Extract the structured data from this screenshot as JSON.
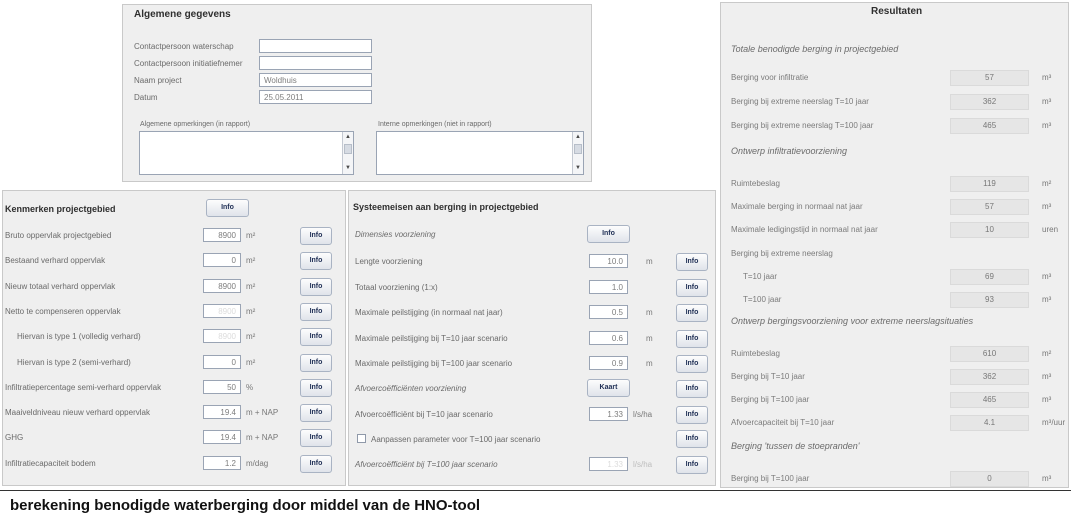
{
  "general": {
    "title": "Algemene gegevens",
    "rows": [
      {
        "label": "Contactpersoon waterschap",
        "value": ""
      },
      {
        "label": "Contactpersoon initiatiefnemer",
        "value": ""
      },
      {
        "label": "Naam project",
        "value": "Woldhuis"
      },
      {
        "label": "Datum",
        "value": "25.05.2011"
      }
    ],
    "remarks_report_label": "Algemene opmerkingen (in rapport)",
    "remarks_internal_label": "Interne opmerkingen (niet in rapport)"
  },
  "project": {
    "title": "Kenmerken projectgebied",
    "info_label": "Info",
    "rows": [
      {
        "label": "Bruto oppervlak projectgebied",
        "value": "8900",
        "unit": "m²",
        "disabled": false
      },
      {
        "label": "Bestaand verhard oppervlak",
        "value": "0",
        "unit": "m²",
        "disabled": false
      },
      {
        "label": "Nieuw totaal verhard oppervlak",
        "value": "8900",
        "unit": "m²",
        "disabled": false
      },
      {
        "label": "Netto te compenseren oppervlak",
        "value": "8900",
        "unit": "m²",
        "disabled": true
      },
      {
        "label": "Hiervan is type 1 (volledig verhard)",
        "value": "8900",
        "unit": "m²",
        "disabled": true
      },
      {
        "label": "Hiervan is type 2 (semi-verhard)",
        "value": "0",
        "unit": "m²",
        "disabled": false
      },
      {
        "label": "Infiltratiepercentage semi-verhard oppervlak",
        "value": "50",
        "unit": "%",
        "disabled": false
      },
      {
        "label": "Maaiveldniveau nieuw verhard oppervlak",
        "value": "19.4",
        "unit": "m + NAP",
        "disabled": false
      },
      {
        "label": "GHG",
        "value": "19.4",
        "unit": "m + NAP",
        "disabled": false
      },
      {
        "label": "Infiltratiecapaciteit bodem",
        "value": "1.2",
        "unit": "m/dag",
        "disabled": false
      }
    ]
  },
  "system": {
    "title": "Systeemeisen aan berging in projectgebied",
    "dimension_label": "Dimensies voorziening",
    "info_label": "Info",
    "kaart_label": "Kaart",
    "rows": [
      {
        "label": "Lengte voorziening",
        "value": "10.0",
        "unit": "m"
      },
      {
        "label": "Totaal voorziening (1:x)",
        "value": "1.0",
        "unit": ""
      },
      {
        "label": "Maximale peilstijging (in normaal nat jaar)",
        "value": "0.5",
        "unit": "m"
      },
      {
        "label": "Maximale peilstijging bij T=10 jaar scenario",
        "value": "0.6",
        "unit": "m"
      },
      {
        "label": "Maximale peilstijging bij T=100 jaar scenario",
        "value": "0.9",
        "unit": "m"
      }
    ],
    "runoff_label": "Afvoercoëfficiënten voorziening",
    "runoff_row": {
      "label": "Afvoercoëfficiënt bij T=10 jaar scenario",
      "value": "1.33",
      "unit": "l/s/ha"
    },
    "checkbox_label": "Aanpassen parameter voor T=100 jaar scenario",
    "runoff100_row": {
      "label": "Afvoercoëfficiënt bij T=100 jaar scenario",
      "value": "1.33",
      "unit": "l/s/ha"
    }
  },
  "results": {
    "title": "Resultaten",
    "groups": [
      {
        "heading": "Totale benodigde berging in projectgebied",
        "rows": [
          {
            "label": "Berging voor infiltratie",
            "value": "57",
            "unit": "m³"
          },
          {
            "label": "Berging bij extreme neerslag T=10 jaar",
            "value": "362",
            "unit": "m³"
          },
          {
            "label": "Berging bij extreme neerslag T=100 jaar",
            "value": "465",
            "unit": "m³"
          }
        ]
      },
      {
        "heading": "Ontwerp infiltratievoorziening",
        "rows": [
          {
            "label": "Ruimtebeslag",
            "value": "119",
            "unit": "m²"
          },
          {
            "label": "Maximale berging in normaal nat jaar",
            "value": "57",
            "unit": "m³"
          },
          {
            "label": "Maximale ledigingstijd in normaal nat jaar",
            "value": "10",
            "unit": "uren"
          },
          {
            "label": "Berging bij extreme neerslag",
            "value": null,
            "unit": ""
          },
          {
            "label": "T=10 jaar",
            "value": "69",
            "unit": "m³"
          },
          {
            "label": "T=100 jaar",
            "value": "93",
            "unit": "m³"
          }
        ]
      },
      {
        "heading": "Ontwerp bergingsvoorziening voor extreme neerslagsituaties",
        "rows": [
          {
            "label": "Ruimtebeslag",
            "value": "610",
            "unit": "m²"
          },
          {
            "label": "Berging bij T=10 jaar",
            "value": "362",
            "unit": "m³"
          },
          {
            "label": "Berging bij T=100 jaar",
            "value": "465",
            "unit": "m³"
          },
          {
            "label": "Afvoercapaciteit bij T=10 jaar",
            "value": "4.1",
            "unit": "m³/uur"
          }
        ]
      },
      {
        "heading": "Berging 'tussen de stoepranden'",
        "rows": [
          {
            "label": "Berging bij T=100 jaar",
            "value": "0",
            "unit": "m³"
          }
        ]
      }
    ]
  },
  "caption": "berekening benodigde waterberging door middel van de HNO-tool"
}
